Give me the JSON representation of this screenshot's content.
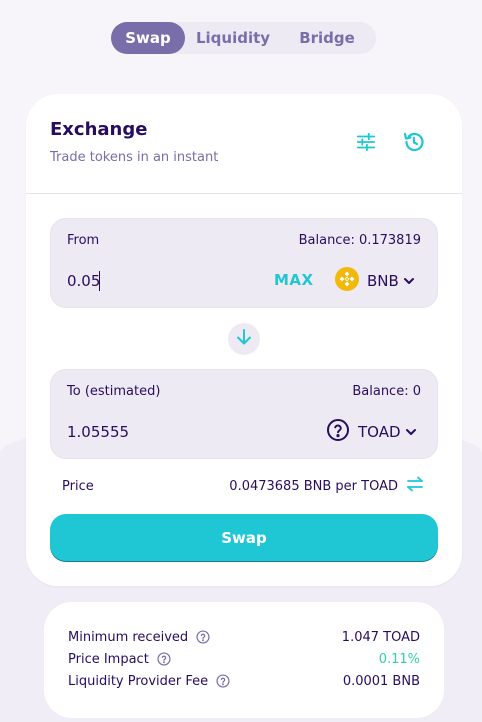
{
  "tabs": [
    {
      "label": "Swap",
      "active": true
    },
    {
      "label": "Liquidity",
      "active": false
    },
    {
      "label": "Bridge",
      "active": false
    }
  ],
  "card": {
    "title": "Exchange",
    "subtitle": "Trade tokens in an instant",
    "icons": [
      "settings-sliders-icon",
      "history-icon"
    ]
  },
  "from": {
    "label": "From",
    "balance": "Balance: 0.173819",
    "value": "0.05",
    "max_label": "MAX",
    "token": "BNB",
    "token_icon": "bnb-logo-icon"
  },
  "swap_direction_icon": "arrow-down-icon",
  "to": {
    "label": "To (estimated)",
    "balance": "Balance: 0",
    "value": "1.05555",
    "token": "TOAD",
    "token_icon": "unknown-token-question-icon"
  },
  "price": {
    "label": "Price",
    "value": "0.0473685 BNB per TOAD",
    "toggle_icon": "swap-horizontal-arrows-icon"
  },
  "swap_button": {
    "label": "Swap"
  },
  "details": [
    {
      "label": "Minimum received",
      "value": "1.047 TOAD"
    },
    {
      "label": "Price Impact",
      "value": "0.11%",
      "color": "#31d0aa"
    },
    {
      "label": "Liquidity Provider Fee",
      "value": "0.0001 BNB"
    }
  ],
  "colors": {
    "primary": "#1fc7d4",
    "secondary": "#7a6eaa",
    "text": "#280d5f",
    "success": "#31d0aa",
    "input_bg": "#eeeaf4",
    "bnb_yellow": "#f0b90b"
  }
}
